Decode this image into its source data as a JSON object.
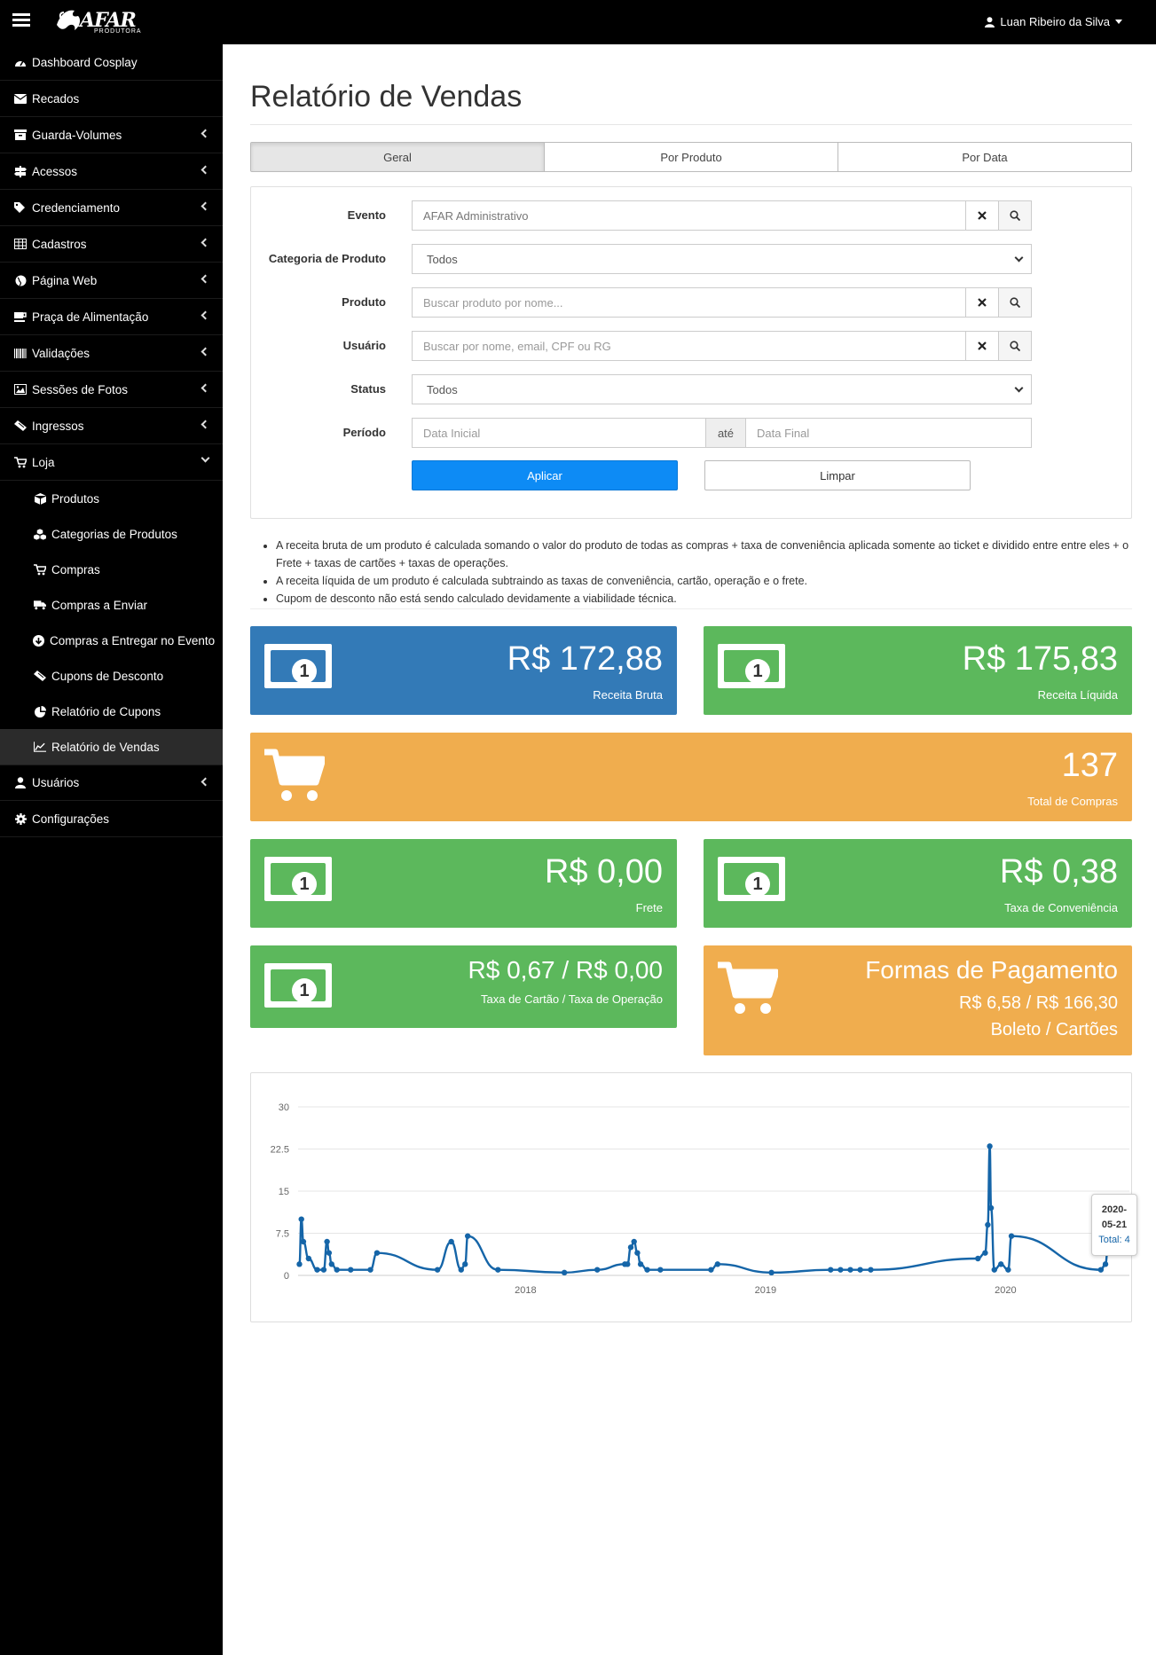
{
  "navbar": {
    "logo_text": "AFAR",
    "logo_sub": "PRODUTORA",
    "user_name": "Luan Ribeiro da Silva"
  },
  "sidebar": {
    "items": [
      {
        "label": "Dashboard Cosplay",
        "icon": "dashboard-icon",
        "has_submenu": false
      },
      {
        "label": "Recados",
        "icon": "envelope-icon",
        "has_submenu": false
      },
      {
        "label": "Guarda-Volumes",
        "icon": "archive-icon",
        "has_submenu": true
      },
      {
        "label": "Acessos",
        "icon": "signpost-icon",
        "has_submenu": true
      },
      {
        "label": "Credenciamento",
        "icon": "tags-icon",
        "has_submenu": true
      },
      {
        "label": "Cadastros",
        "icon": "table-icon",
        "has_submenu": true
      },
      {
        "label": "Página Web",
        "icon": "globe-icon",
        "has_submenu": true
      },
      {
        "label": "Praça de Alimentação",
        "icon": "coffee-icon",
        "has_submenu": true
      },
      {
        "label": "Validações",
        "icon": "barcode-icon",
        "has_submenu": true
      },
      {
        "label": "Sessões de Fotos",
        "icon": "image-icon",
        "has_submenu": true
      },
      {
        "label": "Ingressos",
        "icon": "ticket-icon",
        "has_submenu": true
      },
      {
        "label": "Loja",
        "icon": "cart-icon",
        "has_submenu": true,
        "expanded": true
      }
    ],
    "loja_sub": [
      {
        "label": "Produtos",
        "icon": "cube-icon"
      },
      {
        "label": "Categorias de Produtos",
        "icon": "cubes-icon"
      },
      {
        "label": "Compras",
        "icon": "cart-icon"
      },
      {
        "label": "Compras a Enviar",
        "icon": "truck-icon"
      },
      {
        "label": "Compras a Entregar no Evento",
        "icon": "arrow-circle-down-icon"
      },
      {
        "label": "Cupons de Desconto",
        "icon": "ticket-icon"
      },
      {
        "label": "Relatório de Cupons",
        "icon": "pie-chart-icon"
      },
      {
        "label": "Relatório de Vendas",
        "icon": "line-chart-icon",
        "active": true
      }
    ],
    "after": [
      {
        "label": "Usuários",
        "icon": "user-icon",
        "has_submenu": true
      },
      {
        "label": "Configurações",
        "icon": "cog-icon",
        "has_submenu": false
      }
    ]
  },
  "page": {
    "title": "Relatório de Vendas",
    "tabs": [
      "Geral",
      "Por Produto",
      "Por Data"
    ],
    "active_tab": "Geral"
  },
  "filters": {
    "evento": {
      "label": "Evento",
      "value": "AFAR Administrativo"
    },
    "categoria": {
      "label": "Categoria de Produto",
      "value": "Todos"
    },
    "produto": {
      "label": "Produto",
      "placeholder": "Buscar produto por nome..."
    },
    "usuario": {
      "label": "Usuário",
      "placeholder": "Buscar por nome, email, CPF ou RG"
    },
    "status": {
      "label": "Status",
      "value": "Todos"
    },
    "periodo": {
      "label": "Período",
      "start_placeholder": "Data Inicial",
      "separator": "até",
      "end_placeholder": "Data Final"
    },
    "apply_label": "Aplicar",
    "clear_label": "Limpar"
  },
  "notes": [
    "A receita bruta de um produto é calculada somando o valor do produto de todas as compras + taxa de conveniência aplicada somente ao ticket e dividido entre entre eles + o Frete + taxas de cartões + taxas de operações.",
    "A receita líquida de um produto é calculada subtraindo as taxas de conveniência, cartão, operação e o frete.",
    "Cupom de desconto não está sendo calculado devidamente a viabilidade técnica."
  ],
  "stats": {
    "receita_bruta": {
      "value": "R$ 172,88",
      "label": "Receita Bruta",
      "color": "#337ab7"
    },
    "receita_liquida": {
      "value": "R$ 175,83",
      "label": "Receita Líquida",
      "color": "#5cb85c"
    },
    "total_compras": {
      "value": "137",
      "label": "Total de Compras",
      "color": "#f0ad4e"
    },
    "frete": {
      "value": "R$ 0,00",
      "label": "Frete",
      "color": "#5cb85c"
    },
    "taxa_conveniencia": {
      "value": "R$ 0,38",
      "label": "Taxa de Conveniência",
      "color": "#5cb85c"
    },
    "taxa_cartao_operacao": {
      "value": "R$ 0,67 / R$ 0,00",
      "label": "Taxa de Cartão / Taxa de Operação",
      "color": "#5cb85c"
    },
    "formas_pagamento": {
      "title": "Formas de Pagamento",
      "value": "R$ 6,58 / R$ 166,30",
      "label": "Boleto / Cartões",
      "color": "#f0ad4e"
    }
  },
  "tooltip": {
    "date_line1": "2020-",
    "date_line2": "05-21",
    "total": "Total: 4"
  },
  "chart_data": {
    "type": "line",
    "title": "",
    "xlabel": "",
    "ylabel": "",
    "ylim": [
      0,
      30
    ],
    "yticks": [
      "0",
      "7.5",
      "15",
      "22.5",
      "30"
    ],
    "xticks": [
      "2018",
      "2019",
      "2020"
    ],
    "xlim": [
      "2017-01-20",
      "2020-06-05"
    ],
    "grid": true,
    "color": "#1565a8",
    "series": [
      {
        "points": [
          [
            "2017-01-22",
            2
          ],
          [
            "2017-01-25",
            10
          ],
          [
            "2017-01-28",
            6
          ],
          [
            "2017-02-05",
            3
          ],
          [
            "2017-02-18",
            1
          ],
          [
            "2017-02-28",
            1
          ],
          [
            "2017-03-05",
            6
          ],
          [
            "2017-03-08",
            4
          ],
          [
            "2017-03-12",
            2
          ],
          [
            "2017-03-20",
            1
          ],
          [
            "2017-04-10",
            1
          ],
          [
            "2017-05-10",
            1
          ],
          [
            "2017-05-20",
            4
          ],
          [
            "2017-08-20",
            1
          ],
          [
            "2017-09-10",
            6
          ],
          [
            "2017-09-25",
            1
          ],
          [
            "2017-10-01",
            2
          ],
          [
            "2017-10-05",
            7
          ],
          [
            "2017-11-20",
            1
          ],
          [
            "2018-03-01",
            0.5
          ],
          [
            "2018-04-20",
            1
          ],
          [
            "2018-06-01",
            2
          ],
          [
            "2018-06-05",
            2
          ],
          [
            "2018-06-10",
            5
          ],
          [
            "2018-06-15",
            6
          ],
          [
            "2018-06-20",
            4
          ],
          [
            "2018-06-25",
            2
          ],
          [
            "2018-07-05",
            1
          ],
          [
            "2018-07-25",
            1
          ],
          [
            "2018-10-10",
            1
          ],
          [
            "2018-10-20",
            2
          ],
          [
            "2019-01-10",
            0.5
          ],
          [
            "2019-04-10",
            1
          ],
          [
            "2019-04-25",
            1
          ],
          [
            "2019-05-10",
            1
          ],
          [
            "2019-05-25",
            1
          ],
          [
            "2019-06-10",
            1
          ],
          [
            "2019-11-20",
            3
          ],
          [
            "2019-12-01",
            4
          ],
          [
            "2019-12-05",
            9
          ],
          [
            "2019-12-08",
            23
          ],
          [
            "2019-12-10",
            12
          ],
          [
            "2019-12-15",
            1
          ],
          [
            "2019-12-25",
            2
          ],
          [
            "2020-01-05",
            1
          ],
          [
            "2020-01-10",
            7
          ],
          [
            "2020-05-25",
            1
          ],
          [
            "2020-06-01",
            2
          ],
          [
            "2020-06-04",
            4
          ]
        ]
      }
    ]
  }
}
